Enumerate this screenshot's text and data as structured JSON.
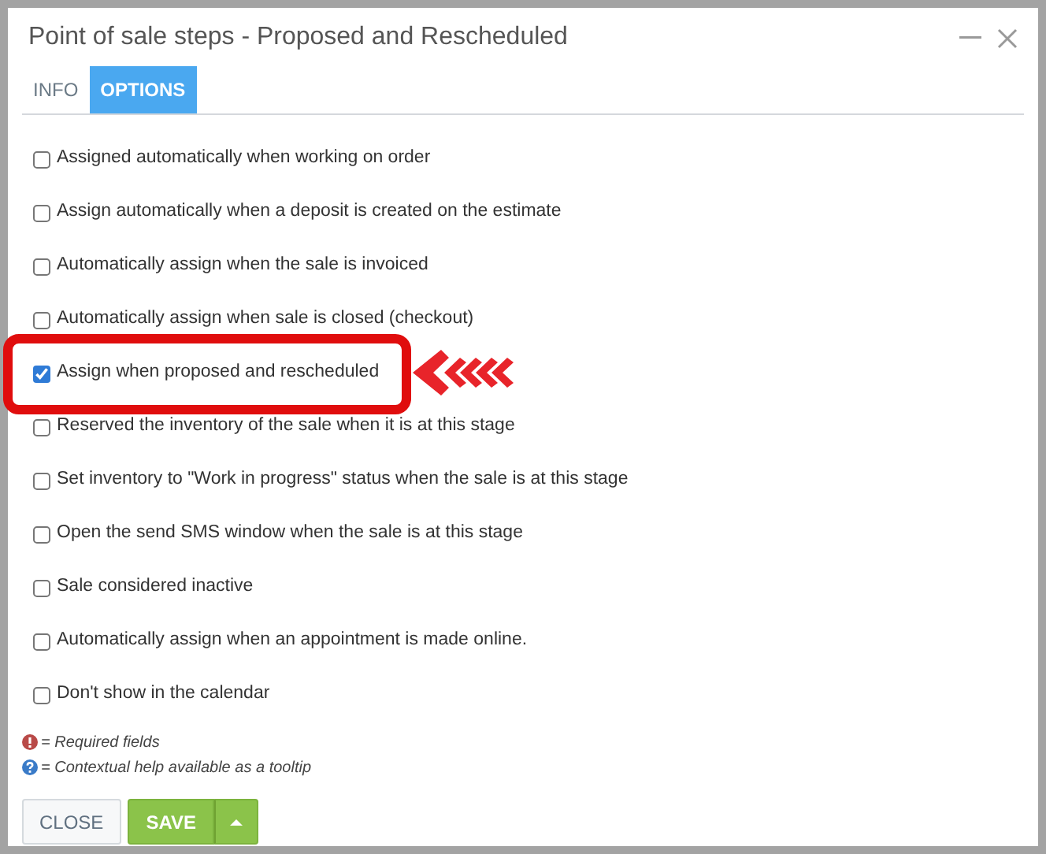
{
  "window": {
    "title": "Point of sale steps - Proposed and Rescheduled"
  },
  "tabs": [
    {
      "label": "INFO",
      "selected": false
    },
    {
      "label": "OPTIONS",
      "selected": true
    }
  ],
  "options": [
    {
      "label": "Assigned automatically when working on order",
      "checked": false,
      "highlighted": false
    },
    {
      "label": "Assign automatically when a deposit is created on the estimate",
      "checked": false,
      "highlighted": false
    },
    {
      "label": "Automatically assign when the sale is invoiced",
      "checked": false,
      "highlighted": false
    },
    {
      "label": "Automatically assign when sale is closed (checkout)",
      "checked": false,
      "highlighted": false
    },
    {
      "label": "Assign when proposed and rescheduled",
      "checked": true,
      "highlighted": true
    },
    {
      "label": "Reserved the inventory of the sale when it is at this stage",
      "checked": false,
      "highlighted": false
    },
    {
      "label": "Set inventory to \"Work in progress\" status when the sale is at this stage",
      "checked": false,
      "highlighted": false
    },
    {
      "label": "Open the send SMS window when the sale is at this stage",
      "checked": false,
      "highlighted": false
    },
    {
      "label": "Sale considered inactive",
      "checked": false,
      "highlighted": false
    },
    {
      "label": "Automatically assign when an appointment is made online.",
      "checked": false,
      "highlighted": false
    },
    {
      "label": "Don't show in the calendar",
      "checked": false,
      "highlighted": false
    }
  ],
  "legend": [
    {
      "kind": "required",
      "text": "= Required fields"
    },
    {
      "kind": "help",
      "text": "= Contextual help available as a tooltip"
    }
  ],
  "buttons": {
    "close": "CLOSE",
    "save": "SAVE"
  }
}
